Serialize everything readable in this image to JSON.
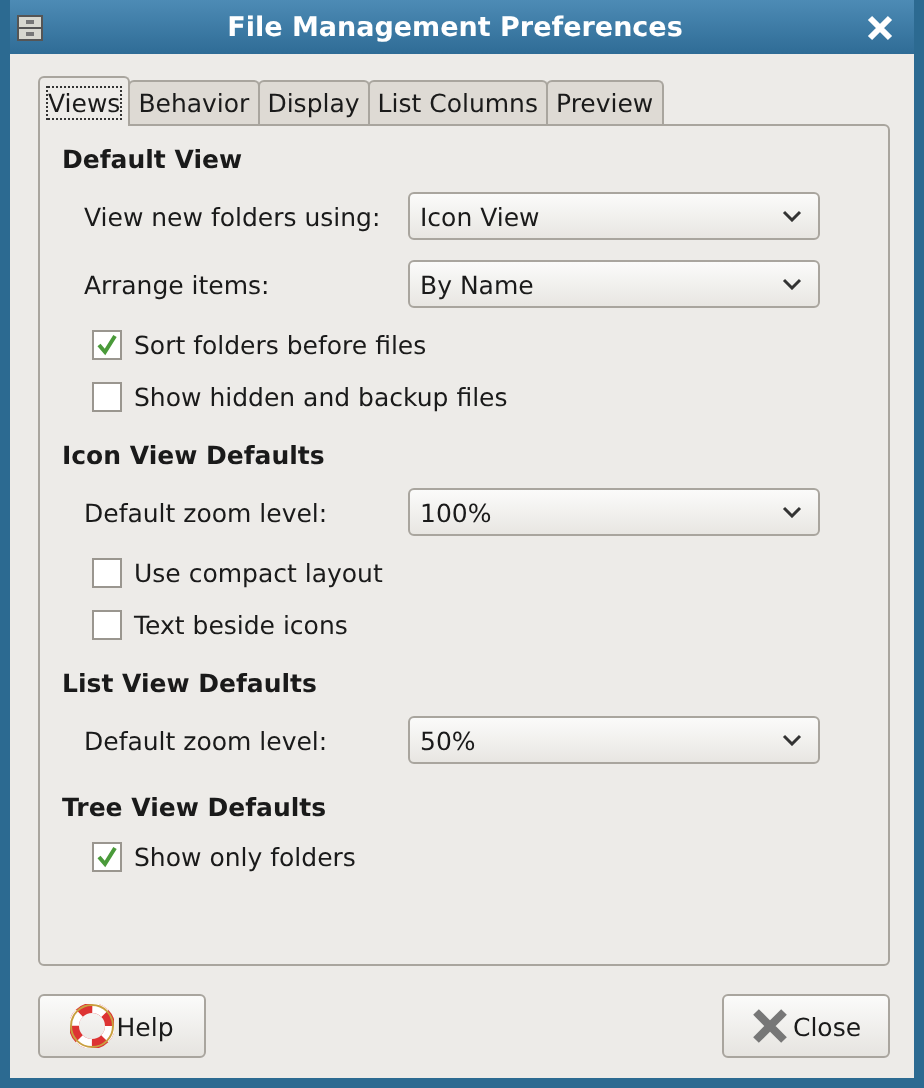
{
  "window": {
    "title": "File Management Preferences"
  },
  "tabs": [
    {
      "label": "Views",
      "selected": true
    },
    {
      "label": "Behavior",
      "selected": false
    },
    {
      "label": "Display",
      "selected": false
    },
    {
      "label": "List Columns",
      "selected": false
    },
    {
      "label": "Preview",
      "selected": false
    }
  ],
  "sections": [
    {
      "heading": "Default View",
      "rows": [
        {
          "kind": "combo",
          "label": "View new folders using:",
          "value": "Icon View"
        },
        {
          "kind": "combo",
          "label": "Arrange items:",
          "value": "By Name"
        },
        {
          "kind": "check",
          "label": "Sort folders before files",
          "checked": true
        },
        {
          "kind": "check",
          "label": "Show hidden and backup files",
          "checked": false
        }
      ]
    },
    {
      "heading": "Icon View Defaults",
      "rows": [
        {
          "kind": "combo",
          "label": "Default zoom level:",
          "value": "100%"
        },
        {
          "kind": "check",
          "label": "Use compact layout",
          "checked": false
        },
        {
          "kind": "check",
          "label": "Text beside icons",
          "checked": false
        }
      ]
    },
    {
      "heading": "List View Defaults",
      "rows": [
        {
          "kind": "combo",
          "label": "Default zoom level:",
          "value": "50%"
        }
      ]
    },
    {
      "heading": "Tree View Defaults",
      "rows": [
        {
          "kind": "check",
          "label": "Show only folders",
          "checked": true
        }
      ]
    }
  ],
  "buttons": [
    {
      "kind": "help",
      "label": "Help"
    },
    {
      "kind": "close",
      "label": "Close"
    }
  ]
}
